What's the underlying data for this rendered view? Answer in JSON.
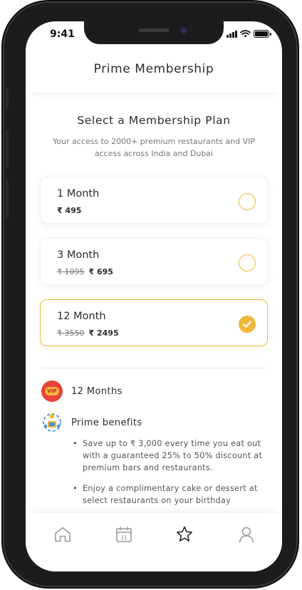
{
  "status_bar": {
    "time": "9:41"
  },
  "header": {
    "title": "Prime Membership"
  },
  "plans_section": {
    "title": "Select a Membership Plan",
    "subtitle": "Your access to 2000+ premium restaurants and VIP access across India and Dubai"
  },
  "plans": [
    {
      "name": "1 Month",
      "old_price": "",
      "price": "₹ 495",
      "selected": false
    },
    {
      "name": "3 Month",
      "old_price": "₹ 1095",
      "price": "₹ 695",
      "selected": false
    },
    {
      "name": "12 Month",
      "old_price": "₹ 3550",
      "price": "₹ 2495",
      "selected": true
    }
  ],
  "summary": {
    "vip_badge_text": "VIP",
    "duration_label": "12 Months",
    "benefits_title": "Prime benefits",
    "benefits": [
      "Save up to ₹ 3,000 every time you eat out with a guaranteed 25% to 50% discount at premium bars and restaurants.",
      "Enjoy a complimentary cake or dessert at select restaurants on your birthday"
    ]
  },
  "tabbar": {
    "items": [
      {
        "icon": "home-icon"
      },
      {
        "icon": "calendar-icon",
        "text": "31"
      },
      {
        "icon": "star-icon",
        "active": true
      },
      {
        "icon": "profile-icon"
      }
    ]
  },
  "colors": {
    "accent": "#f1b73a",
    "vip_red": "#e8443a",
    "text": "#2b2b2b"
  }
}
